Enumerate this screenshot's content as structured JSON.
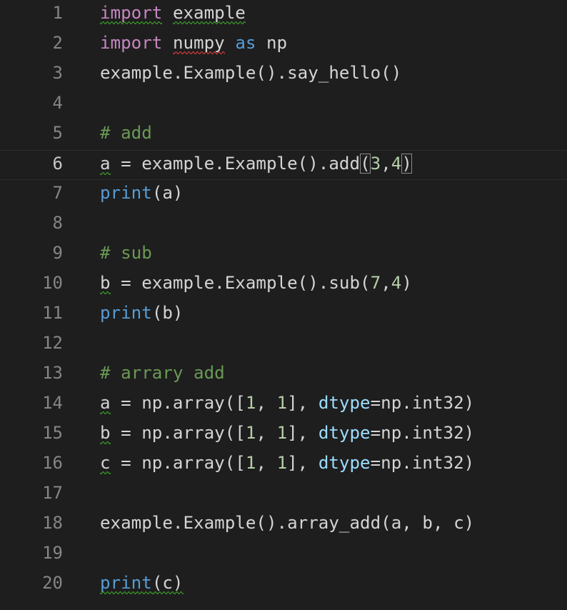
{
  "editor": {
    "current_line": 6,
    "colors": {
      "background": "#1e1e1e",
      "keyword": "#c586c0",
      "builtin": "#569cd6",
      "number": "#b5cea8",
      "comment": "#6a9955",
      "parameter": "#9cdcfe",
      "text": "#d4d4d4",
      "warning_squiggle": "#3c9a2b",
      "error_squiggle": "#d23b3b"
    },
    "lines": [
      {
        "n": "1",
        "tokens": [
          [
            "kw-import",
            "import"
          ],
          [
            "plain",
            " "
          ],
          [
            "plain",
            "example"
          ]
        ]
      },
      {
        "n": "2",
        "tokens": [
          [
            "kw-import",
            "import"
          ],
          [
            "plain",
            " "
          ],
          [
            "plain",
            "numpy"
          ],
          [
            "plain",
            " "
          ],
          [
            "kw-as",
            "as"
          ],
          [
            "plain",
            " np"
          ]
        ]
      },
      {
        "n": "3",
        "tokens": [
          [
            "plain",
            "example.Example().say_hello()"
          ]
        ]
      },
      {
        "n": "4",
        "tokens": []
      },
      {
        "n": "5",
        "tokens": [
          [
            "comment",
            "# add"
          ]
        ]
      },
      {
        "n": "6",
        "tokens": [
          [
            "plain",
            "a"
          ],
          [
            "plain",
            " = example.Example().add"
          ],
          [
            "plain",
            "("
          ],
          [
            "num",
            "3"
          ],
          [
            "plain",
            ","
          ],
          [
            "num",
            "4"
          ],
          [
            "plain",
            ")"
          ]
        ]
      },
      {
        "n": "7",
        "tokens": [
          [
            "builtin",
            "print"
          ],
          [
            "plain",
            "(a)"
          ]
        ]
      },
      {
        "n": "8",
        "tokens": []
      },
      {
        "n": "9",
        "tokens": [
          [
            "comment",
            "# sub"
          ]
        ]
      },
      {
        "n": "10",
        "tokens": [
          [
            "plain",
            "b"
          ],
          [
            "plain",
            " = example.Example().sub("
          ],
          [
            "num",
            "7"
          ],
          [
            "plain",
            ","
          ],
          [
            "num",
            "4"
          ],
          [
            "plain",
            ")"
          ]
        ]
      },
      {
        "n": "11",
        "tokens": [
          [
            "builtin",
            "print"
          ],
          [
            "plain",
            "(b)"
          ]
        ]
      },
      {
        "n": "12",
        "tokens": []
      },
      {
        "n": "13",
        "tokens": [
          [
            "comment",
            "# arrary add"
          ]
        ]
      },
      {
        "n": "14",
        "tokens": [
          [
            "plain",
            "a"
          ],
          [
            "plain",
            " = np.array(["
          ],
          [
            "num",
            "1"
          ],
          [
            "plain",
            ", "
          ],
          [
            "num",
            "1"
          ],
          [
            "plain",
            "], "
          ],
          [
            "param",
            "dtype"
          ],
          [
            "plain",
            "=np.int32)"
          ]
        ]
      },
      {
        "n": "15",
        "tokens": [
          [
            "plain",
            "b"
          ],
          [
            "plain",
            " = np.array(["
          ],
          [
            "num",
            "1"
          ],
          [
            "plain",
            ", "
          ],
          [
            "num",
            "1"
          ],
          [
            "plain",
            "], "
          ],
          [
            "param",
            "dtype"
          ],
          [
            "plain",
            "=np.int32)"
          ]
        ]
      },
      {
        "n": "16",
        "tokens": [
          [
            "plain",
            "c"
          ],
          [
            "plain",
            " = np.array(["
          ],
          [
            "num",
            "1"
          ],
          [
            "plain",
            ", "
          ],
          [
            "num",
            "1"
          ],
          [
            "plain",
            "], "
          ],
          [
            "param",
            "dtype"
          ],
          [
            "plain",
            "=np.int32)"
          ]
        ]
      },
      {
        "n": "17",
        "tokens": []
      },
      {
        "n": "18",
        "tokens": [
          [
            "plain",
            "example.Example().array_add(a, b, c)"
          ]
        ]
      },
      {
        "n": "19",
        "tokens": []
      },
      {
        "n": "20",
        "tokens": [
          [
            "builtin",
            "print"
          ],
          [
            "plain",
            "(c)"
          ]
        ]
      }
    ]
  }
}
